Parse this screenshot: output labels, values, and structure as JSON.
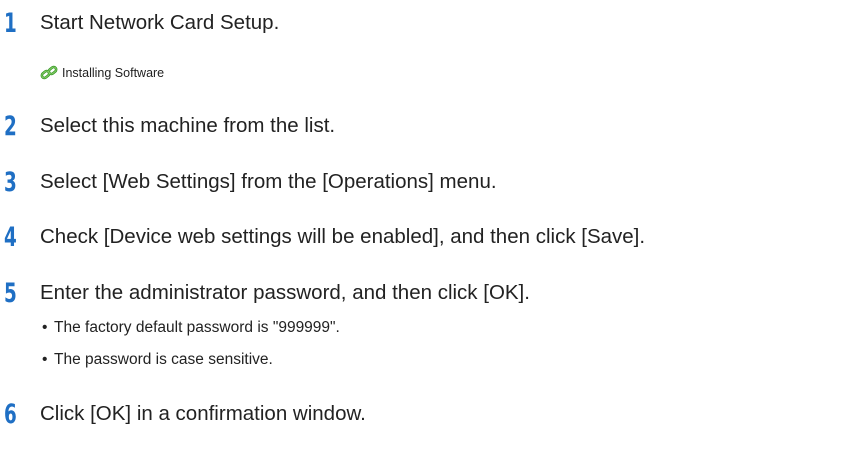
{
  "steps": [
    {
      "number": "1",
      "text": "Start Network Card Setup."
    },
    {
      "number": "2",
      "text": "Select this machine from the list."
    },
    {
      "number": "3",
      "text": "Select [Web Settings] from the [Operations] menu."
    },
    {
      "number": "4",
      "text": "Check [Device web settings will be enabled], and then click [Save]."
    },
    {
      "number": "5",
      "text": "Enter the administrator password, and then click [OK]."
    },
    {
      "number": "6",
      "text": "Click [OK] in a confirmation window."
    }
  ],
  "link": {
    "label": "Installing Software",
    "icon": "chain-link-icon",
    "color": "#3a9a2a"
  },
  "notes": [
    "The factory default password is \"999999\".",
    "The password is case sensitive."
  ],
  "bullet_char": "•",
  "accent_color": "#1f6fc4"
}
